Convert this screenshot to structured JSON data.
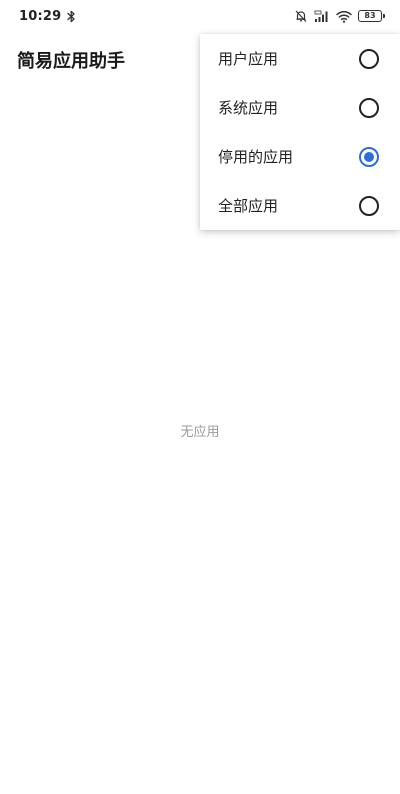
{
  "status_bar": {
    "time": "10:29",
    "battery": "83",
    "icons": [
      "bluetooth-icon",
      "bell-off-icon",
      "signal-icon",
      "wifi-icon",
      "battery-icon"
    ]
  },
  "app_bar": {
    "title": "简易应用助手"
  },
  "main": {
    "empty_text": "无应用"
  },
  "menu": {
    "items": [
      {
        "label": "用户应用",
        "checked": false
      },
      {
        "label": "系统应用",
        "checked": false
      },
      {
        "label": "停用的应用",
        "checked": true
      },
      {
        "label": "全部应用",
        "checked": false
      }
    ]
  },
  "colors": {
    "accent": "#2f6fd0",
    "empty_text": "#9a9a9a"
  }
}
